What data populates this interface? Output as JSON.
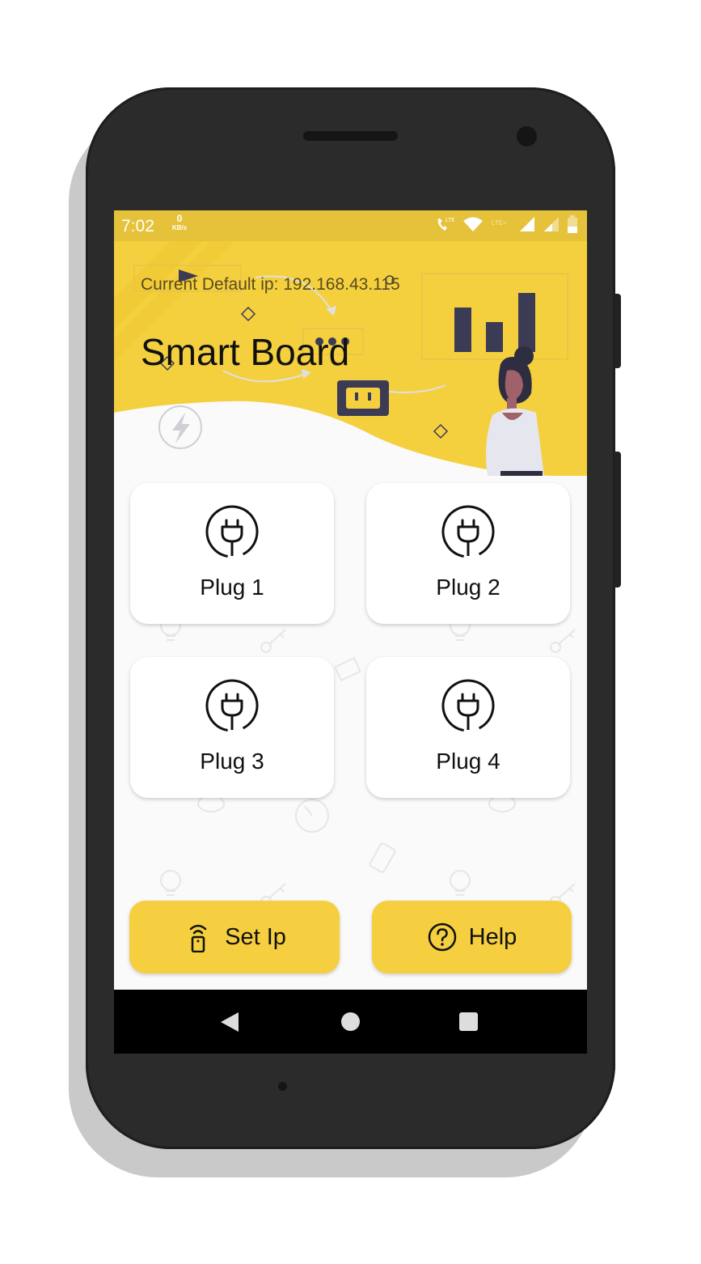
{
  "status_bar": {
    "time": "7:02",
    "speed_value": "0",
    "speed_unit": "KB/s",
    "icons": [
      "call-lte-icon",
      "wifi-icon",
      "lte-plus-icon",
      "signal-icon",
      "signal-icon",
      "battery-icon"
    ]
  },
  "header": {
    "ip_line": "Current Default ip: 192.168.43.115",
    "title": "Smart Board",
    "accent_color": "#f4d03f"
  },
  "plugs": [
    {
      "label": "Plug 1",
      "icon": "plug-icon"
    },
    {
      "label": "Plug 2",
      "icon": "plug-icon"
    },
    {
      "label": "Plug 3",
      "icon": "plug-icon"
    },
    {
      "label": "Plug 4",
      "icon": "plug-icon"
    }
  ],
  "actions": {
    "set_ip": {
      "label": "Set Ip",
      "icon": "router-icon"
    },
    "help": {
      "label": "Help",
      "icon": "help-circle-icon"
    },
    "button_color": "#f5cf3f"
  },
  "nav_bar": {
    "icons": [
      "back-icon",
      "home-icon",
      "recents-icon"
    ]
  }
}
